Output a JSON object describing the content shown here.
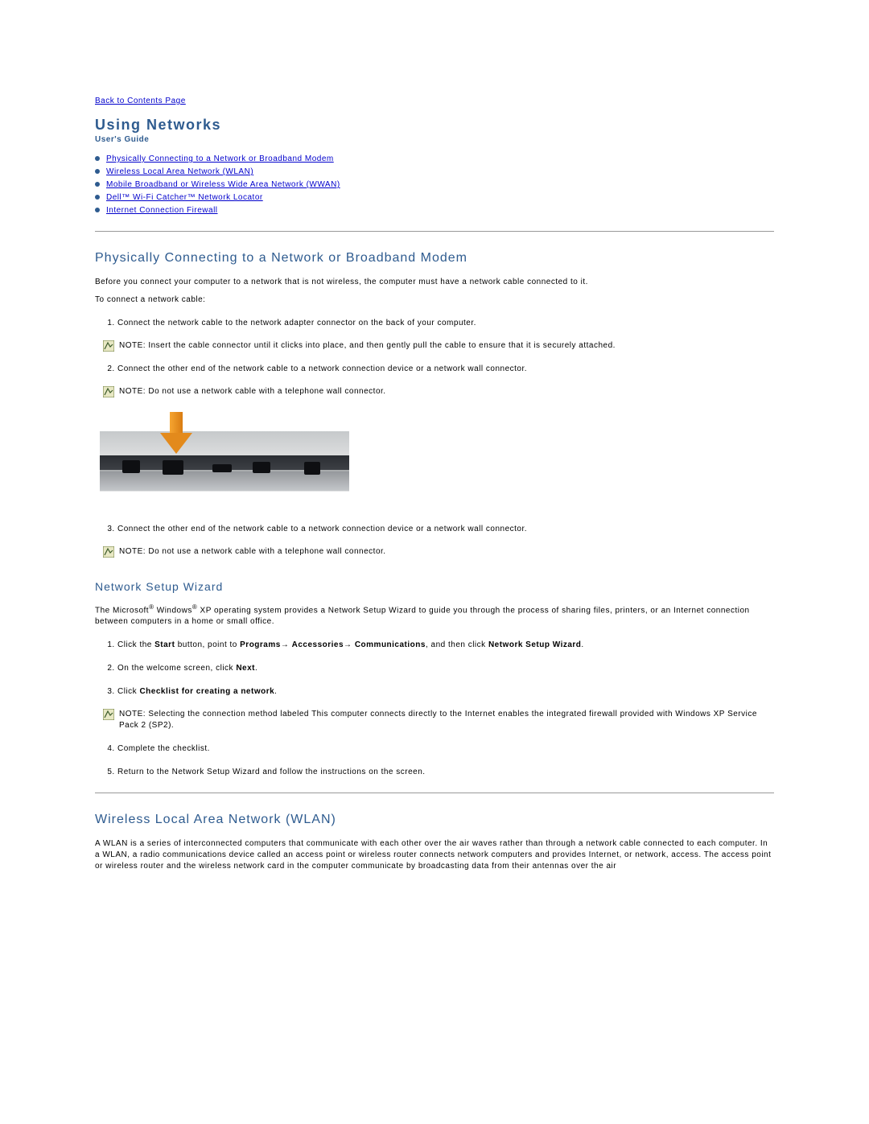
{
  "back_link": "Back to Contents Page",
  "title": "Using Networks",
  "subtitle": "User's Guide",
  "toc": [
    "Physically Connecting to a Network or Broadband Modem",
    "Wireless Local Area Network (WLAN)",
    "Mobile Broadband or Wireless Wide Area Network (WWAN)",
    "Dell™ Wi-Fi Catcher™ Network Locator",
    "Internet Connection Firewall"
  ],
  "section1": {
    "heading": "Physically Connecting to a Network or Broadband Modem",
    "intro": "Before you connect your computer to a network that is not wireless, the computer must have a network cable connected to it.",
    "intro2": "To connect a network cable:",
    "step1": "Connect the network cable to the network adapter connector on the back of your computer.",
    "note1_label": "NOTE:",
    "note1": " Insert the cable connector until it clicks into place, and then gently pull the cable to ensure that it is securely attached.",
    "step2": "Connect the other end of the network cable to a network connection device or a network wall connector.",
    "note2_label": "NOTE:",
    "note2": " Do not use a network cable with a telephone wall connector.",
    "step3": "Connect the other end of the network cable to a network connection device or a network wall connector.",
    "note3_label": "NOTE:",
    "note3": " Do not use a network cable with a telephone wall connector."
  },
  "section2": {
    "heading": "Network Setup Wizard",
    "p1a": "The Microsoft",
    "p1b": " Windows",
    "p1c": " XP operating system provides a Network Setup Wizard to guide you through the process of sharing files, printers, or an Internet connection between computers in a home or small office.",
    "step1a": "Click the ",
    "step1b": "Start",
    "step1c": " button, point to ",
    "step1d": "Programs",
    "step1e": "→ ",
    "step1f": "Accessories",
    "step1g": "→ ",
    "step1h": "Communications",
    "step1i": ", and then click ",
    "step1j": "Network Setup Wizard",
    "step1k": ".",
    "step2a": "On the welcome screen, click ",
    "step2b": "Next",
    "step2c": ".",
    "step3a": "Click ",
    "step3b": "Checklist for creating a network",
    "step3c": ".",
    "note_label": "NOTE:",
    "note": " Selecting the connection method labeled This computer connects directly to the Internet enables the integrated firewall provided with Windows XP Service Pack 2 (SP2).",
    "step4": "Complete the checklist.",
    "step5": "Return to the Network Setup Wizard and follow the instructions on the screen."
  },
  "section3": {
    "heading": "Wireless Local Area Network (WLAN)",
    "p1": "A WLAN is a series of interconnected computers that communicate with each other over the air waves rather than through a network cable connected to each computer. In a WLAN, a radio communications device called an access point or wireless router connects network computers and provides Internet, or network, access. The access point or wireless router and the wireless network card in the computer communicate by broadcasting data from their antennas over the air"
  }
}
